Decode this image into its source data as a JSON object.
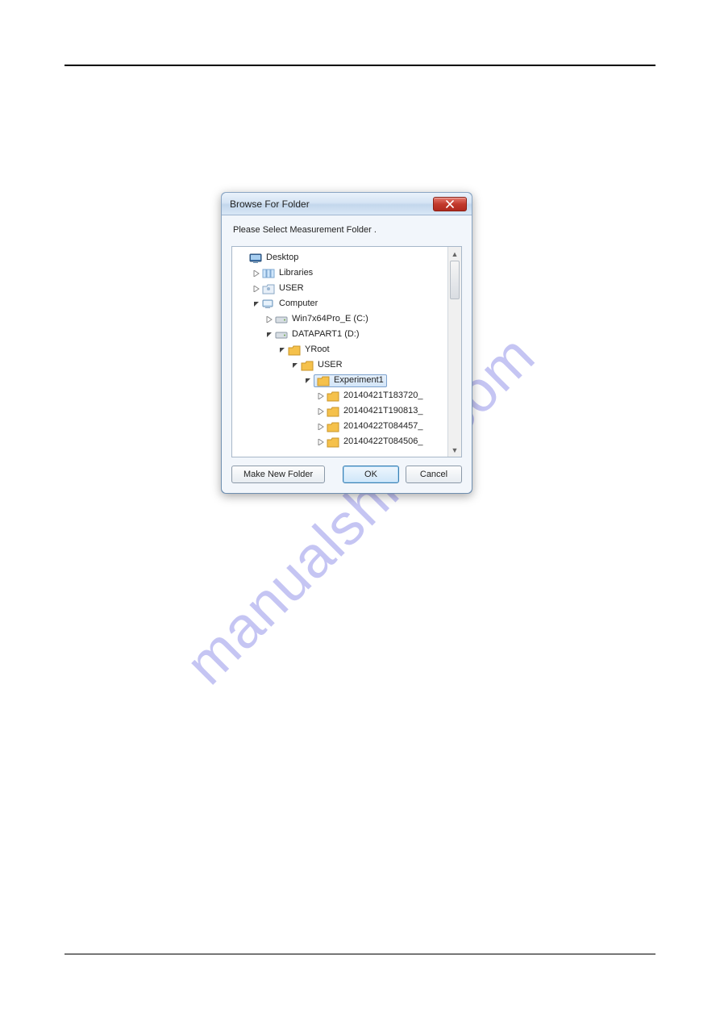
{
  "watermark": "manualshive.com",
  "dialog": {
    "title": "Browse For Folder",
    "prompt": "Please Select Measurement Folder .",
    "buttons": {
      "make": "Make New Folder",
      "ok": "OK",
      "cancel": "Cancel"
    },
    "tree": {
      "desktop": "Desktop",
      "libraries": "Libraries",
      "user": "USER",
      "computer": "Computer",
      "drive_c": "Win7x64Pro_E (C:)",
      "drive_d": "DATAPART1 (D:)",
      "yroot": "YRoot",
      "user2": "USER",
      "experiment1": "Experiment1",
      "f1": "20140421T183720_",
      "f2": "20140421T190813_",
      "f3": "20140422T084457_",
      "f4": "20140422T084506_"
    }
  }
}
